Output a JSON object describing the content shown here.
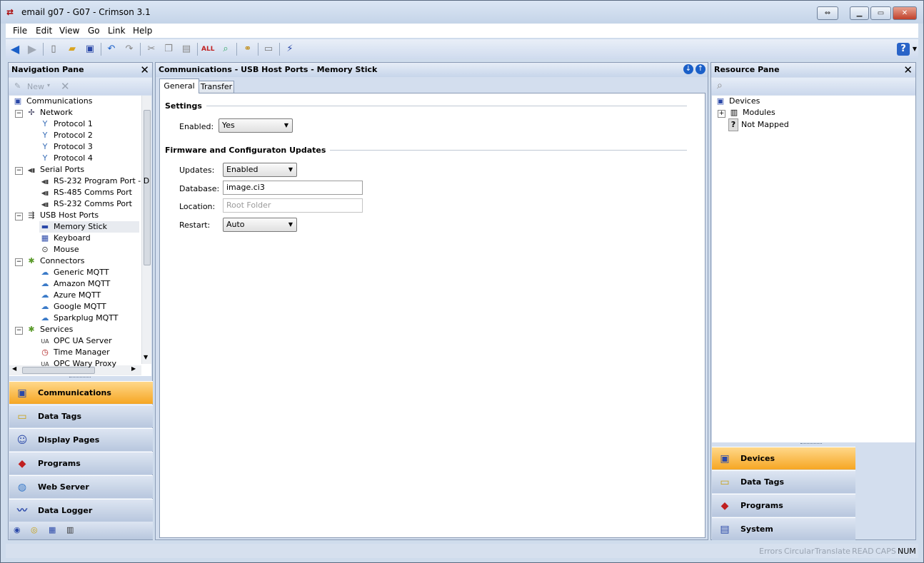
{
  "window": {
    "title": "email g07 - G07 - Crimson 3.1",
    "app_icon": "crimson-app-icon"
  },
  "menu": [
    "File",
    "Edit",
    "View",
    "Go",
    "Link",
    "Help"
  ],
  "toolbar": {
    "icons": [
      "back-icon",
      "forward-icon",
      "new-icon",
      "open-icon",
      "save-icon",
      "undo-icon",
      "redo-icon",
      "cut-icon",
      "copy-icon",
      "paste-icon",
      "spell-icon",
      "find-icon",
      "link-icon",
      "window-icon",
      "wand-icon"
    ],
    "help_icon": "help-icon"
  },
  "nav": {
    "title": "Navigation Pane",
    "new_label": "New",
    "tree": [
      {
        "label": "Communications",
        "level": 0
      },
      {
        "label": "Network",
        "level": 1
      },
      {
        "label": "Protocol 1",
        "level": 2
      },
      {
        "label": "Protocol 2",
        "level": 2
      },
      {
        "label": "Protocol 3",
        "level": 2
      },
      {
        "label": "Protocol 4",
        "level": 2
      },
      {
        "label": "Serial Ports",
        "level": 1
      },
      {
        "label": "RS-232 Program Port - D",
        "level": 2
      },
      {
        "label": "RS-485 Comms Port",
        "level": 2
      },
      {
        "label": "RS-232 Comms Port",
        "level": 2
      },
      {
        "label": "USB Host Ports",
        "level": 1
      },
      {
        "label": "Memory Stick",
        "level": 2
      },
      {
        "label": "Keyboard",
        "level": 2
      },
      {
        "label": "Mouse",
        "level": 2
      },
      {
        "label": "Connectors",
        "level": 1
      },
      {
        "label": "Generic MQTT",
        "level": 2
      },
      {
        "label": "Amazon MQTT",
        "level": 2
      },
      {
        "label": "Azure MQTT",
        "level": 2
      },
      {
        "label": "Google MQTT",
        "level": 2
      },
      {
        "label": "Sparkplug MQTT",
        "level": 2
      },
      {
        "label": "Services",
        "level": 1
      },
      {
        "label": "OPC UA Server",
        "level": 2
      },
      {
        "label": "Time Manager",
        "level": 2
      },
      {
        "label": "OPC Wary Proxy",
        "level": 2
      }
    ],
    "categories": [
      "Communications",
      "Data Tags",
      "Display Pages",
      "Programs",
      "Web Server",
      "Data Logger"
    ]
  },
  "main": {
    "title": "Communications - USB Host Ports - Memory Stick",
    "tabs": [
      "General",
      "Transfer"
    ],
    "settings_group": "Settings",
    "enabled_label": "Enabled:",
    "enabled_value": "Yes",
    "updates_group": "Firmware and Configuraton Updates",
    "updates_label": "Updates:",
    "updates_value": "Enabled",
    "database_label": "Database:",
    "database_value": "image.ci3",
    "location_label": "Location:",
    "location_placeholder": "Root Folder",
    "restart_label": "Restart:",
    "restart_value": "Auto"
  },
  "resource": {
    "title": "Resource Pane",
    "tree": [
      "Devices",
      "Modules",
      "Not Mapped"
    ],
    "categories": [
      "Devices",
      "Data Tags",
      "Programs",
      "System"
    ]
  },
  "status": [
    "Errors",
    "Circular",
    "Translate",
    "READ",
    "CAPS",
    "NUM"
  ]
}
